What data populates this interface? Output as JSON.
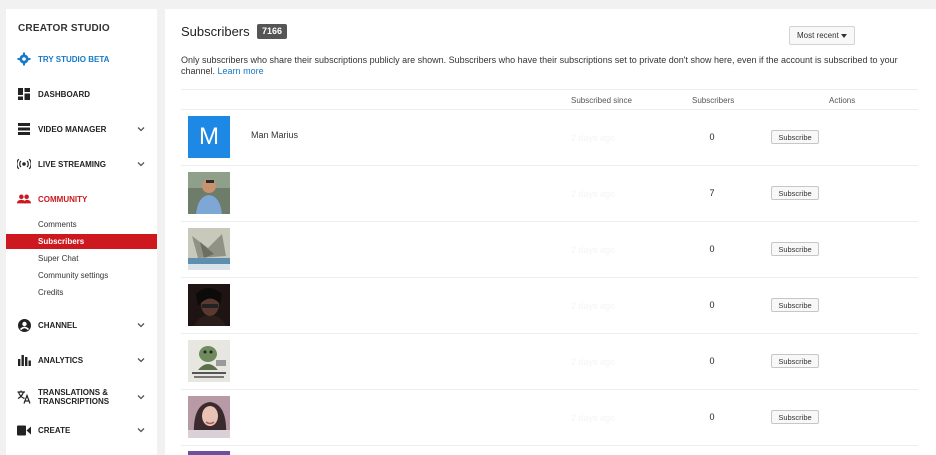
{
  "sidebar": {
    "title": "CREATOR STUDIO",
    "items": [
      {
        "label": "TRY STUDIO BETA",
        "icon": "gear-icon"
      },
      {
        "label": "DASHBOARD",
        "icon": "dashboard-icon"
      },
      {
        "label": "VIDEO MANAGER",
        "icon": "video-manager-icon"
      },
      {
        "label": "LIVE STREAMING",
        "icon": "live-streaming-icon"
      },
      {
        "label": "COMMUNITY",
        "icon": "community-icon"
      },
      {
        "label": "CHANNEL",
        "icon": "channel-icon"
      },
      {
        "label": "ANALYTICS",
        "icon": "analytics-icon"
      },
      {
        "label": "TRANSLATIONS & TRANSCRIPTIONS",
        "icon": "translate-icon"
      },
      {
        "label": "CREATE",
        "icon": "create-icon"
      }
    ],
    "community_sub": [
      "Comments",
      "Subscribers",
      "Super Chat",
      "Community settings",
      "Credits"
    ]
  },
  "main": {
    "title": "Subscribers",
    "count": "7166",
    "sort_label": "Most recent",
    "description": "Only subscribers who share their subscriptions publicly are shown. Subscribers who have their subscriptions set to private don't show here, even if the account is subscribed to your channel.",
    "learn_more": "Learn more",
    "columns": {
      "since": "Subscribed since",
      "subscribers": "Subscribers",
      "actions": "Actions"
    },
    "rows": [
      {
        "name": "Man Marius",
        "since": "2 days ago",
        "subscribers": "0",
        "action": "Subscribe"
      },
      {
        "name": "",
        "since": "2 days ago",
        "subscribers": "7",
        "action": "Subscribe"
      },
      {
        "name": "",
        "since": "2 days ago",
        "subscribers": "0",
        "action": "Subscribe"
      },
      {
        "name": "",
        "since": "2 days ago",
        "subscribers": "0",
        "action": "Subscribe"
      },
      {
        "name": "",
        "since": "2 days ago",
        "subscribers": "0",
        "action": "Subscribe"
      },
      {
        "name": "",
        "since": "2 days ago",
        "subscribers": "0",
        "action": "Subscribe"
      }
    ],
    "avatar_letter": "M"
  },
  "colors": {
    "accent_red": "#cc181e",
    "link_blue": "#167ac6",
    "avatar_blue": "#1e88e5"
  }
}
